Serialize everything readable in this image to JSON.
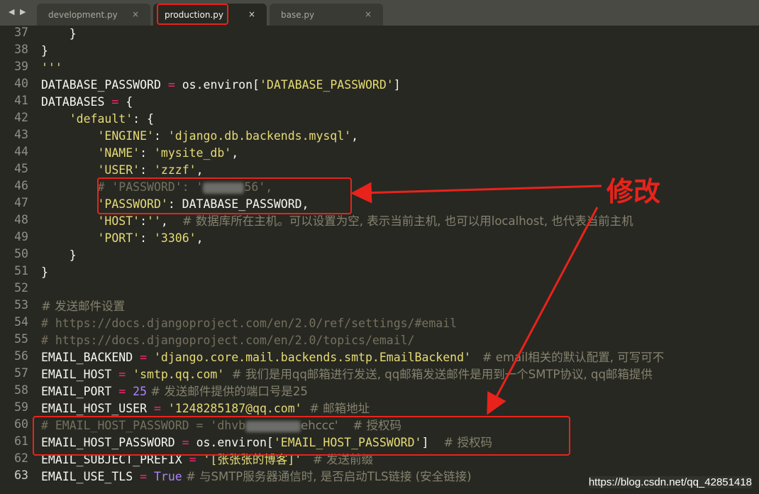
{
  "window": {
    "nav_arrows": "◀ ▶",
    "tabs": [
      {
        "label": "development.py",
        "close": "×"
      },
      {
        "label": "production.py",
        "close": "×"
      },
      {
        "label": "base.py",
        "close": "×"
      }
    ]
  },
  "editor": {
    "line_numbers": [
      "37",
      "38",
      "39",
      "40",
      "41",
      "42",
      "43",
      "44",
      "45",
      "46",
      "47",
      "48",
      "49",
      "50",
      "51",
      "52",
      "53",
      "54",
      "55",
      "56",
      "57",
      "58",
      "59",
      "60",
      "61",
      "62",
      "63"
    ],
    "code_text": {
      "l37": "    }",
      "l38": "}",
      "l39": "'''",
      "l40_a": "DATABASE_PASSWORD",
      "l40_b": " = ",
      "l40_c": "os.environ[",
      "l40_d": "'DATABASE_PASSWORD'",
      "l40_e": "]",
      "l41_a": "DATABASES",
      "l41_b": " = ",
      "l41_c": "{",
      "l42_a": "    'default'",
      "l42_b": ": {",
      "l43_a": "        'ENGINE'",
      "l43_b": ": ",
      "l43_c": "'django.db.backends.mysql'",
      "l43_d": ",",
      "l44_a": "        'NAME'",
      "l44_b": ": ",
      "l44_c": "'mysite_db'",
      "l44_d": ",",
      "l45_a": "        'USER'",
      "l45_b": ": ",
      "l45_c": "'zzzf'",
      "l45_d": ",",
      "l46_a": "        # 'PASSWORD': '",
      "l46_b": "56',",
      "l47_a": "        'PASSWORD'",
      "l47_b": ": DATABASE_PASSWORD,",
      "l48_a": "        'HOST'",
      "l48_b": ":",
      "l48_c": "''",
      "l48_d": ",  ",
      "l48_e": "# 数据库所在主机。可以设置为空, 表示当前主机, 也可以用localhost, 也代表当前主机",
      "l49_a": "        'PORT'",
      "l49_b": ": ",
      "l49_c": "'3306'",
      "l49_d": ",",
      "l50": "    }",
      "l51": "}",
      "l53": "# 发送邮件设置",
      "l54": "# https://docs.djangoproject.com/en/2.0/ref/settings/#email",
      "l55": "# https://docs.djangoproject.com/en/2.0/topics/email/",
      "l56_a": "EMAIL_BACKEND",
      "l56_b": " = ",
      "l56_c": "'django.core.mail.backends.smtp.EmailBackend'",
      "l56_d": "   # email相关的默认配置, 可写可不",
      "l57_a": "EMAIL_HOST",
      "l57_b": " = ",
      "l57_c": "'smtp.qq.com'",
      "l57_d": "  # 我们是用qq邮箱进行发送, qq邮箱发送邮件是用到一个SMTP协议, qq邮箱提供",
      "l58_a": "EMAIL_PORT",
      "l58_b": " = ",
      "l58_c": "25",
      "l58_d": " # 发送邮件提供的端口号是25",
      "l59_a": "EMAIL_HOST_USER",
      "l59_b": " = ",
      "l59_c": "'1248285187@qq.com'",
      "l59_d": "  # 邮箱地址",
      "l60_a": "# EMAIL_HOST_PASSWORD = 'dhvb",
      "l60_b": "ehccc'    # 授权码",
      "l61_a": "EMAIL_HOST_PASSWORD",
      "l61_b": " = ",
      "l61_c": "os.environ[",
      "l61_d": "'EMAIL_HOST_PASSWORD'",
      "l61_e": "]",
      "l61_f": "    # 授权码",
      "l62_a": "EMAIL_SUBJECT_PREFIX",
      "l62_b": " = ",
      "l62_c": "'[张张张的博客]'",
      "l62_d": "   # 发送前缀",
      "l63_a": "EMAIL_USE_TLS",
      "l63_b": " = ",
      "l63_c": "True",
      "l63_d": " # 与SMTP服务器通信时, 是否启动TLS链接 (安全链接)"
    }
  },
  "annotation": {
    "label": "修改"
  },
  "watermark": "https://blog.csdn.net/qq_42851418",
  "colors": {
    "background": "#272822",
    "annotation_red": "#e8231b",
    "string": "#e6db74",
    "operator": "#f92672",
    "number": "#ae81ff",
    "comment": "#75715e"
  }
}
